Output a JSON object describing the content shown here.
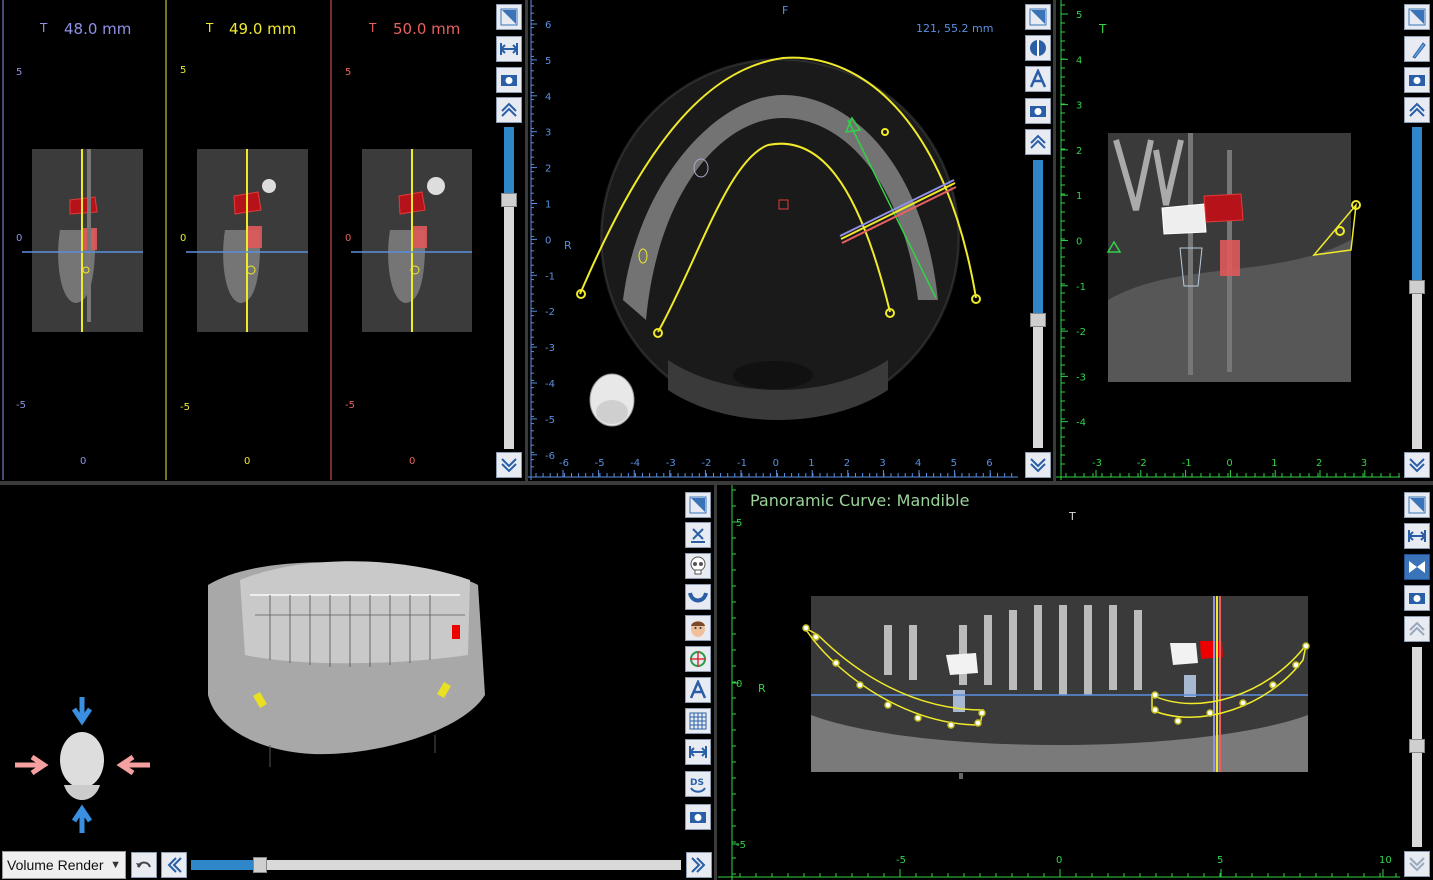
{
  "colors": {
    "yellow": "#f0ea2a",
    "blue": "#5b8fe0",
    "red": "#e53a3a",
    "green": "#32d24a",
    "lightgreen": "#9ad39a",
    "tool_bg": "#e8ecf2",
    "scroll_fill": "#2f86c9"
  },
  "cross_sections": [
    {
      "label_letter": "T",
      "thickness": "48.0 mm",
      "line_color": "#8f92e6",
      "axis_top": "5",
      "axis_zero": "0",
      "axis_bottom": "-5",
      "axis_x": "0",
      "marker": "B"
    },
    {
      "label_letter": "T",
      "thickness": "49.0 mm",
      "line_color": "#f0ea2a",
      "axis_top": "5",
      "axis_zero": "0",
      "axis_bottom": "-5",
      "axis_x": "0",
      "marker": "B"
    },
    {
      "label_letter": "T",
      "thickness": "50.0 mm",
      "line_color": "#e86060",
      "axis_top": "5",
      "axis_zero": "0",
      "axis_bottom": "-5",
      "axis_x": "0",
      "marker": "B"
    }
  ],
  "axial": {
    "top_label": "F",
    "left_label": "R",
    "coord_readout": "121, 55.2 mm",
    "y_ticks": [
      "6",
      "5",
      "4",
      "3",
      "2",
      "1",
      "0",
      "-1",
      "-2",
      "-3",
      "-4",
      "-5",
      "-6"
    ],
    "x_ticks": [
      "-6",
      "-5",
      "-4",
      "-3",
      "-2",
      "-1",
      "0",
      "1",
      "2",
      "3",
      "4",
      "5",
      "6"
    ]
  },
  "sagittal": {
    "top_label": "T",
    "y_ticks": [
      "5",
      "4",
      "3",
      "2",
      "1",
      "0",
      "-1",
      "-2",
      "-3",
      "-4"
    ],
    "x_ticks": [
      "-3",
      "-2",
      "-1",
      "0",
      "1",
      "2",
      "3"
    ]
  },
  "panoramic": {
    "title": "Panoramic Curve: Mandible",
    "top_label": "T",
    "left_label": "R",
    "y_ticks": [
      "5",
      "0",
      "-5"
    ],
    "x_ticks": [
      "-5",
      "0",
      "5",
      "10"
    ]
  },
  "volume": {
    "mode_select": "Volume Render",
    "slider_value": 0.22
  },
  "toolbars": {
    "cross": [
      "crosshair-icon",
      "width-icon",
      "camera-icon",
      "page-up-icon",
      "page-down-icon"
    ],
    "axial": [
      "crosshair-icon",
      "contrast-icon",
      "annotation-icon",
      "camera-icon",
      "page-up-icon",
      "page-down-icon"
    ],
    "sagittal": [
      "crosshair-icon",
      "implant-icon",
      "camera-icon",
      "page-up-icon",
      "page-down-icon"
    ],
    "volume": [
      "crosshair-icon",
      "clip-icon",
      "skull-icon",
      "arch-icon",
      "face-icon",
      "orientation-icon",
      "annotation-icon",
      "grid-icon",
      "width-icon",
      "ds-icon",
      "camera-icon"
    ],
    "panoramic": [
      "crosshair-icon",
      "width-icon",
      "bowtie-icon",
      "camera-icon",
      "page-up-icon"
    ]
  }
}
